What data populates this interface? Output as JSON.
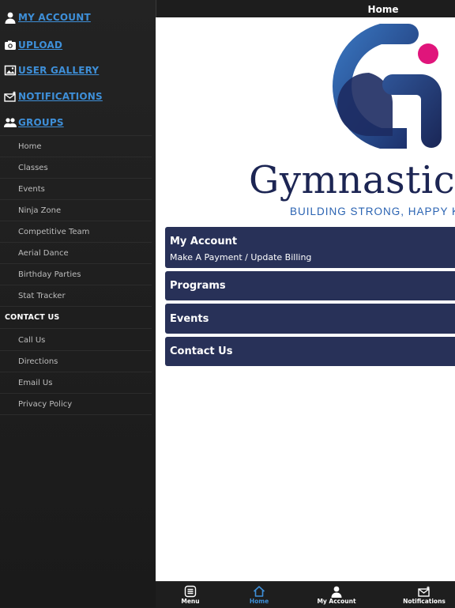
{
  "sidebar": {
    "top_links": [
      {
        "label": "MY ACCOUNT",
        "icon": "person-icon"
      },
      {
        "label": "UPLOAD",
        "icon": "camera-icon"
      },
      {
        "label": "USER GALLERY",
        "icon": "gallery-icon"
      },
      {
        "label": "NOTIFICATIONS",
        "icon": "mail-icon"
      },
      {
        "label": "GROUPS",
        "icon": "group-icon"
      }
    ],
    "group_items": [
      "Home",
      "Classes",
      "Events",
      "Ninja Zone",
      "Competitive Team",
      "Aerial Dance",
      "Birthday Parties",
      "Stat Tracker"
    ],
    "contact_heading": "CONTACT US",
    "contact_items": [
      "Call Us",
      "Directions",
      "Email Us",
      "Privacy Policy"
    ]
  },
  "header": {
    "title": "Home"
  },
  "logo": {
    "wordmark": "Gymnastics",
    "tagline": "BUILDING STRONG, HAPPY K",
    "colors": {
      "navy": "#1c2553",
      "blue": "#2a63b2",
      "magenta": "#e0157b"
    }
  },
  "cards": [
    {
      "title": "My Account",
      "subtitle": "Make A Payment / Update Billing"
    },
    {
      "title": "Programs"
    },
    {
      "title": "Events"
    },
    {
      "title": "Contact Us"
    }
  ],
  "tabbar": {
    "tabs": [
      {
        "label": "Menu",
        "icon": "menu-icon",
        "active": false
      },
      {
        "label": "Home",
        "icon": "home-icon",
        "active": true
      },
      {
        "label": "My Account",
        "icon": "person-icon",
        "active": false
      },
      {
        "label": "Notifications",
        "icon": "mail-icon",
        "active": false
      }
    ]
  },
  "colors": {
    "accent": "#3e8fd8",
    "card": "#283158",
    "sidebar": "#1f1f1f"
  }
}
